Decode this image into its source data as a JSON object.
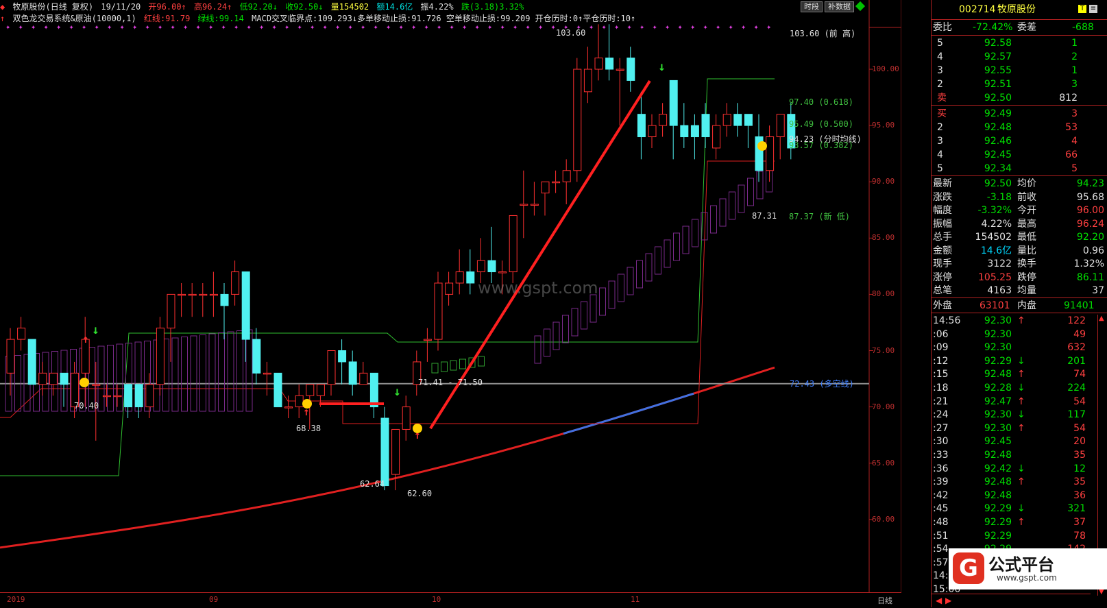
{
  "header": {
    "line1": {
      "stock": "牧原股份(日线 复权)",
      "date": "19/11/20",
      "open": "开96.00↑",
      "high": "高96.24↑",
      "low": "低92.20↓",
      "close": "收92.50↓",
      "volume": "量154502",
      "amount": "额14.6亿",
      "amplitude": "振4.22%",
      "change": "跌(3.18)3.32%"
    },
    "line2": {
      "indicator": "双色龙交易系统&原油(10000,1)",
      "red_line": "红线:91.79",
      "green_line": "绿线:99.14",
      "rest": "MACD交叉临界点:109.293↓多单移动止损:91.726 空单移动止损:99.209 开仓历时:0↑平仓历时:10↑"
    },
    "buttons": [
      "时段",
      "补数据"
    ]
  },
  "price_axis": {
    "ticks": [
      "100.00",
      "95.00",
      "90.00",
      "85.00",
      "80.00",
      "75.00",
      "70.00",
      "65.00",
      "60.00"
    ]
  },
  "date_axis": {
    "labels": [
      "2019",
      "09",
      "10",
      "11"
    ],
    "right_label": "日线"
  },
  "annotations": {
    "prev_high": "103.60 (前 高)",
    "fib_618": "97.40 (0.618)",
    "fib_500": "95.49 (0.500)",
    "avg_line": "94.23 (分时均线)",
    "fib_382": "93.57 (0.382)",
    "new_low": "87.37 (新 低)",
    "long_short": "72.43 (多空线)",
    "peak": "103.60",
    "low_62_64": "62.64",
    "low_62_60": "62.60",
    "range": "71.41 - 71.50",
    "val_70_40": "70.40",
    "val_68_38": "68.38",
    "val_87_31": "87.31"
  },
  "watermark": "www.gspt.com",
  "right_panel": {
    "code": "002714",
    "name": "牧原股份",
    "weibi_label": "委比",
    "weibi_val": "-72.42%",
    "weicha_label": "委差",
    "weicha_val": "-688",
    "asks": [
      {
        "lvl": "5",
        "price": "92.58",
        "vol": "1"
      },
      {
        "lvl": "4",
        "price": "92.57",
        "vol": "2"
      },
      {
        "lvl": "3",
        "price": "92.55",
        "vol": "1"
      },
      {
        "lvl": "2",
        "price": "92.51",
        "vol": "3"
      },
      {
        "lvl": "卖",
        "price": "92.50",
        "vol": "812"
      }
    ],
    "bids": [
      {
        "lvl": "买",
        "price": "92.49",
        "vol": "3"
      },
      {
        "lvl": "2",
        "price": "92.48",
        "vol": "53"
      },
      {
        "lvl": "3",
        "price": "92.46",
        "vol": "4"
      },
      {
        "lvl": "4",
        "price": "92.45",
        "vol": "66"
      },
      {
        "lvl": "5",
        "price": "92.34",
        "vol": "5"
      }
    ],
    "stats": [
      {
        "l1": "最新",
        "v1": "92.50",
        "c1": "grn",
        "l2": "均价",
        "v2": "94.23",
        "c2": "grn"
      },
      {
        "l1": "涨跌",
        "v1": "-3.18",
        "c1": "grn",
        "l2": "前收",
        "v2": "95.68",
        "c2": "wht"
      },
      {
        "l1": "幅度",
        "v1": "-3.32%",
        "c1": "grn",
        "l2": "今开",
        "v2": "96.00",
        "c2": "red"
      },
      {
        "l1": "振幅",
        "v1": "4.22%",
        "c1": "wht",
        "l2": "最高",
        "v2": "96.24",
        "c2": "red"
      },
      {
        "l1": "总手",
        "v1": "154502",
        "c1": "wht",
        "l2": "最低",
        "v2": "92.20",
        "c2": "grn"
      },
      {
        "l1": "金额",
        "v1": "14.6亿",
        "c1": "cyn",
        "l2": "量比",
        "v2": "0.96",
        "c2": "wht"
      },
      {
        "l1": "现手",
        "v1": "3122",
        "c1": "wht",
        "l2": "换手",
        "v2": "1.32%",
        "c2": "wht"
      },
      {
        "l1": "涨停",
        "v1": "105.25",
        "c1": "red",
        "l2": "跌停",
        "v2": "86.11",
        "c2": "grn"
      },
      {
        "l1": "总笔",
        "v1": "4163",
        "c1": "wht",
        "l2": "均量",
        "v2": "37",
        "c2": "wht"
      }
    ],
    "outer_label": "外盘",
    "outer_val": "63101",
    "inner_label": "内盘",
    "inner_val": "91401",
    "ticks": [
      {
        "t": "14:56",
        "p": "92.30",
        "d": "↑",
        "v": "122",
        "c": "red"
      },
      {
        "t": ":06",
        "p": "92.30",
        "d": "",
        "v": "49",
        "c": "red"
      },
      {
        "t": ":09",
        "p": "92.30",
        "d": "",
        "v": "632",
        "c": "red"
      },
      {
        "t": ":12",
        "p": "92.29",
        "d": "↓",
        "v": "201",
        "c": "grn"
      },
      {
        "t": ":15",
        "p": "92.48",
        "d": "↑",
        "v": "74",
        "c": "red"
      },
      {
        "t": ":18",
        "p": "92.28",
        "d": "↓",
        "v": "224",
        "c": "grn"
      },
      {
        "t": ":21",
        "p": "92.47",
        "d": "↑",
        "v": "54",
        "c": "red"
      },
      {
        "t": ":24",
        "p": "92.30",
        "d": "↓",
        "v": "117",
        "c": "grn"
      },
      {
        "t": ":27",
        "p": "92.30",
        "d": "↑",
        "v": "54",
        "c": "red"
      },
      {
        "t": ":30",
        "p": "92.45",
        "d": "",
        "v": "20",
        "c": "red"
      },
      {
        "t": ":33",
        "p": "92.48",
        "d": "",
        "v": "35",
        "c": "red"
      },
      {
        "t": ":36",
        "p": "92.42",
        "d": "↓",
        "v": "12",
        "c": "grn"
      },
      {
        "t": ":39",
        "p": "92.48",
        "d": "↑",
        "v": "35",
        "c": "red"
      },
      {
        "t": ":42",
        "p": "92.48",
        "d": "",
        "v": "36",
        "c": "red"
      },
      {
        "t": ":45",
        "p": "92.29",
        "d": "↓",
        "v": "321",
        "c": "grn"
      },
      {
        "t": ":48",
        "p": "92.29",
        "d": "↑",
        "v": "37",
        "c": "red"
      },
      {
        "t": ":51",
        "p": "92.29",
        "d": "",
        "v": "78",
        "c": "red"
      },
      {
        "t": ":54",
        "p": "92.29",
        "d": "",
        "v": "142",
        "c": "red"
      },
      {
        "t": ":57",
        "p": "92.29",
        "d": "",
        "v": "278",
        "c": "red"
      },
      {
        "t": "14:57",
        "p": "",
        "d": "",
        "v": "",
        "c": "red"
      },
      {
        "t": "15:00",
        "p": "",
        "d": "",
        "v": "",
        "c": "red"
      }
    ],
    "logo_text": "公式平台",
    "logo_url": "www.gspt.com"
  },
  "chart_data": {
    "type": "candlestick",
    "candles": [
      [
        73,
        77,
        71,
        76
      ],
      [
        76,
        78,
        75,
        77
      ],
      [
        76,
        76,
        72,
        72
      ],
      [
        72,
        74,
        71,
        73
      ],
      [
        72,
        73,
        71,
        73
      ],
      [
        73,
        73,
        70,
        72
      ],
      [
        70,
        74,
        69,
        73
      ],
      [
        73,
        78,
        70,
        76
      ],
      [
        72,
        74,
        67,
        72
      ],
      [
        71,
        72,
        70,
        71
      ],
      [
        71,
        72,
        70,
        71
      ],
      [
        72,
        72,
        69,
        70
      ],
      [
        72,
        72,
        69,
        70
      ],
      [
        70,
        73,
        69,
        72
      ],
      [
        72,
        78,
        71,
        77
      ],
      [
        77,
        80,
        74,
        80
      ],
      [
        80,
        81,
        78,
        80
      ],
      [
        80,
        81,
        78,
        80
      ],
      [
        80,
        81,
        78,
        80
      ],
      [
        80,
        82,
        78,
        80
      ],
      [
        80,
        81,
        76,
        79
      ],
      [
        80,
        83,
        79,
        82
      ],
      [
        82,
        82,
        74,
        76
      ],
      [
        76,
        77,
        72,
        73
      ],
      [
        73,
        74,
        71,
        73
      ],
      [
        73,
        73,
        70,
        70
      ],
      [
        70,
        71,
        69,
        70
      ],
      [
        70,
        72,
        69,
        71
      ],
      [
        71,
        72,
        68,
        72
      ],
      [
        71,
        72,
        70,
        72
      ],
      [
        72,
        75,
        71,
        75
      ],
      [
        75,
        76,
        72,
        74
      ],
      [
        74,
        75,
        71,
        72
      ],
      [
        72,
        74,
        72,
        73
      ],
      [
        73,
        73,
        69,
        70
      ],
      [
        69,
        70,
        62.6,
        63
      ],
      [
        64,
        68,
        62.6,
        68
      ],
      [
        68,
        71,
        67,
        70
      ],
      [
        72,
        75,
        71,
        74
      ],
      [
        76,
        77,
        74,
        76
      ],
      [
        76,
        82,
        75,
        81
      ],
      [
        80,
        82,
        79,
        81
      ],
      [
        81,
        84,
        80,
        82
      ],
      [
        82,
        84,
        80,
        81
      ],
      [
        82,
        85,
        81,
        83
      ],
      [
        83,
        86,
        81,
        82
      ],
      [
        82,
        83,
        80,
        82
      ],
      [
        82,
        87,
        81,
        87
      ],
      [
        88,
        91,
        85,
        88
      ],
      [
        88,
        90,
        87,
        88
      ],
      [
        89,
        90,
        87,
        90
      ],
      [
        90,
        91,
        89,
        90
      ],
      [
        90,
        92,
        88,
        91
      ],
      [
        91,
        101,
        90,
        100
      ],
      [
        98,
        102,
        97,
        100
      ],
      [
        100,
        104,
        99,
        101
      ],
      [
        101,
        104,
        99,
        100
      ],
      [
        100,
        101,
        95,
        100
      ],
      [
        101,
        102,
        98,
        99
      ],
      [
        96,
        98,
        92,
        94
      ],
      [
        94,
        96,
        93,
        95
      ],
      [
        95,
        97,
        94,
        96
      ],
      [
        99,
        99,
        92,
        95
      ],
      [
        95,
        97,
        93,
        94
      ],
      [
        95,
        96,
        92,
        94
      ],
      [
        96,
        97,
        93,
        94
      ],
      [
        93,
        96,
        92,
        95
      ],
      [
        95,
        97,
        94,
        96
      ],
      [
        96,
        97,
        94,
        95
      ],
      [
        96,
        96,
        93,
        95
      ],
      [
        94,
        96,
        90,
        91
      ],
      [
        91,
        95,
        90,
        94
      ],
      [
        94,
        96,
        92,
        96
      ],
      [
        96,
        97,
        92,
        93
      ]
    ],
    "long_short_line": 72.43,
    "prev_high": 103.6,
    "new_low": 87.37
  }
}
